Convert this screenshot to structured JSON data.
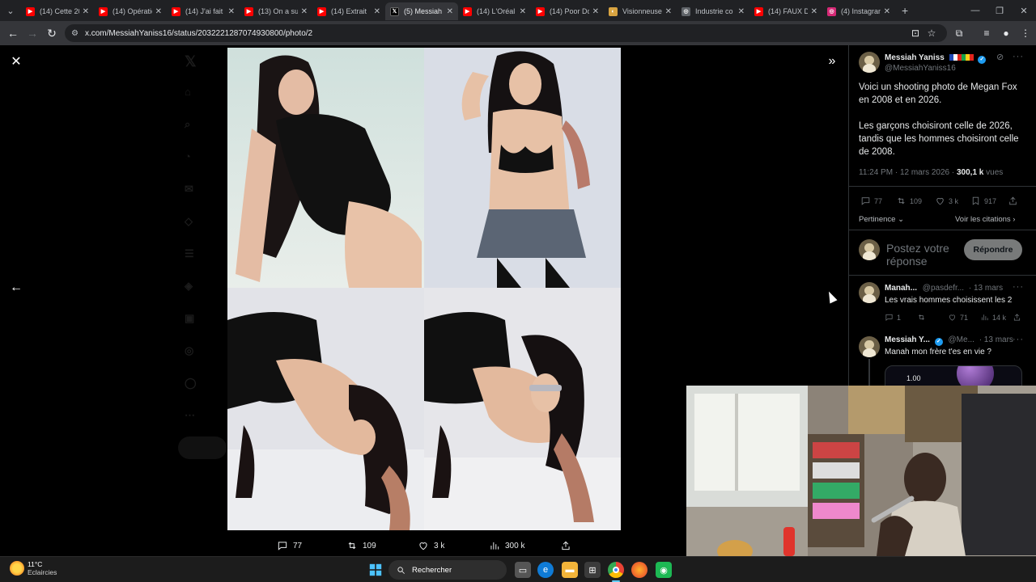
{
  "browser": {
    "tabs": [
      {
        "label": "(14) Cette 20",
        "favicon": "youtube-icon",
        "active": false
      },
      {
        "label": "(14) Opératio",
        "favicon": "youtube-icon",
        "active": false
      },
      {
        "label": "(14) J'ai fait",
        "favicon": "youtube-icon",
        "active": false
      },
      {
        "label": "(13) On a su",
        "favicon": "youtube-icon",
        "active": false
      },
      {
        "label": "(14) Extrait",
        "favicon": "youtube-icon",
        "active": false
      },
      {
        "label": "(5) Messiah",
        "favicon": "x-icon",
        "active": true
      },
      {
        "label": "(14) L'Oréal",
        "favicon": "youtube-icon",
        "active": false
      },
      {
        "label": "(14) Poor Do",
        "favicon": "youtube-icon",
        "active": false
      },
      {
        "label": "Visionneuse",
        "favicon": "viewer-icon",
        "active": false
      },
      {
        "label": "Industrie co",
        "favicon": "page-icon",
        "active": false
      },
      {
        "label": "(14) FAUX D",
        "favicon": "youtube-icon",
        "active": false
      },
      {
        "label": "(4) Instagran",
        "favicon": "instagram-icon",
        "active": false
      }
    ],
    "url": "x.com/MessiahYaniss16/status/2032221287074930800/photo/2"
  },
  "viewer": {
    "close": "✕",
    "prev": "←",
    "expand": "»",
    "actions": {
      "replies": "77",
      "reposts": "109",
      "likes": "3 k",
      "views": "300 k"
    }
  },
  "post": {
    "author_name": "Messiah Yaniss",
    "author_handle": "@MessiahYaniss16",
    "text_p1": "Voici un shooting photo de Megan Fox en 2008 et en 2026.",
    "text_p2": "Les garçons choisiront celle de 2026, tandis que les hommes choisiront celle de 2008.",
    "time": "11:24 PM · 12 mars 2026 · ",
    "views_count": "300,1 k",
    "views_label": " vues",
    "stats": {
      "replies": "77",
      "reposts": "109",
      "likes": "3 k",
      "bookmarks": "917"
    },
    "sort_label": "Pertinence",
    "quotes_link": "Voir les citations",
    "reply_placeholder": "Postez votre réponse",
    "reply_button": "Répondre"
  },
  "replies": [
    {
      "name": "Manah...",
      "handle": "@pasdefr...",
      "date": "· 13 mars",
      "text": "Les vrais hommes choisissent les 2",
      "replies": "1",
      "reposts": "",
      "likes": "71",
      "views": "14 k"
    },
    {
      "name": "Messiah Y...",
      "handle": "@Me...",
      "date": "· 13 mars",
      "text": "Manah mon frère t'es en vie ?",
      "chip_text": "1.00"
    }
  ],
  "taskbar": {
    "temperature": "11°C",
    "weather": "Eclaircies",
    "search_placeholder": "Rechercher"
  },
  "colors": {
    "x_background": "#000000",
    "chrome_dark": "#202124",
    "chrome_toolbar": "#35363a",
    "x_accent": "#1d9bf0",
    "youtube_red": "#ff0000"
  }
}
